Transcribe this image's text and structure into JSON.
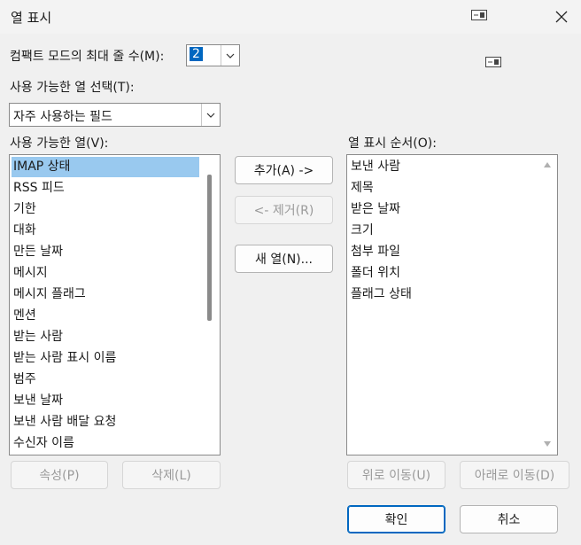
{
  "window": {
    "title": "열 표시",
    "icon": "column-display-icon",
    "close": "close-icon"
  },
  "compact": {
    "label": "컴팩트 모드의 최대 줄 수(M):",
    "value": "2"
  },
  "field_select": {
    "label": "사용 가능한 열 선택(T):",
    "value": "자주 사용하는 필드"
  },
  "available": {
    "label": "사용 가능한 열(V):",
    "items": [
      "IMAP 상태",
      "RSS 피드",
      "기한",
      "대화",
      "만든 날짜",
      "메시지",
      "메시지 플래그",
      "멘션",
      "받는 사람",
      "받는 사람 표시 이름",
      "범주",
      "보낸 날짜",
      "보낸 사람 배달 요청",
      "수신자 이름"
    ],
    "selected_index": 0
  },
  "display": {
    "label": "열 표시 순서(O):",
    "items": [
      "보낸 사람",
      "제목",
      "받은 날짜",
      "크기",
      "첨부 파일",
      "폴더 위치",
      "플래그 상태"
    ]
  },
  "buttons": {
    "add": "추가(A) ->",
    "remove": "<- 제거(R)",
    "new_column": "새 열(N)...",
    "properties": "속성(P)",
    "delete": "삭제(L)",
    "move_up": "위로 이동(U)",
    "move_down": "아래로 이동(D)",
    "ok": "확인",
    "cancel": "취소"
  },
  "colors": {
    "selection": "#99c9ef",
    "accent": "#0067c0"
  }
}
